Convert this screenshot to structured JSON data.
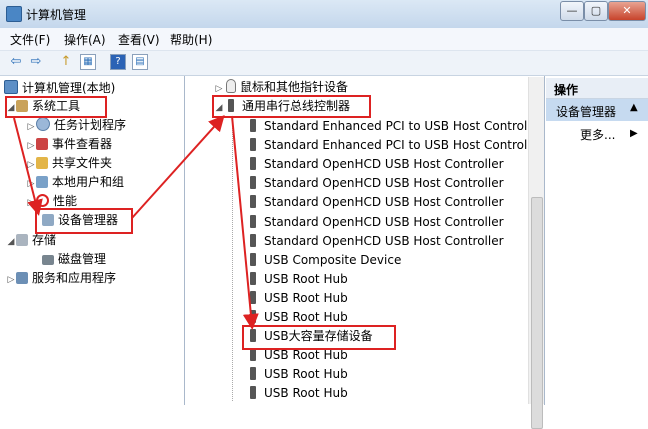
{
  "window": {
    "title": "计算机管理",
    "btn_min": "—",
    "btn_max": "▢",
    "btn_close": "✕"
  },
  "menu": {
    "file": "文件(F)",
    "action": "操作(A)",
    "view": "查看(V)",
    "help": "帮助(H)"
  },
  "toolbar": {
    "back": "⇦",
    "forward": "⇨",
    "up": "↑",
    "show": "▦",
    "help": "?",
    "pane": "▤"
  },
  "left_tree": {
    "root": "计算机管理(本地)",
    "system_tools": "系统工具",
    "task_scheduler": "任务计划程序",
    "event_viewer": "事件查看器",
    "shared_folders": "共享文件夹",
    "local_users": "本地用户和组",
    "performance": "性能",
    "device_manager": "设备管理器",
    "storage": "存储",
    "disk_management": "磁盘管理",
    "services_apps": "服务和应用程序"
  },
  "device_tree": {
    "mice": "鼠标和其他指针设备",
    "usb_controllers": "通用串行总线控制器",
    "items": [
      "Standard Enhanced PCI to USB Host Controller",
      "Standard Enhanced PCI to USB Host Controller",
      "Standard OpenHCD USB Host Controller",
      "Standard OpenHCD USB Host Controller",
      "Standard OpenHCD USB Host Controller",
      "Standard OpenHCD USB Host Controller",
      "Standard OpenHCD USB Host Controller",
      "USB Composite Device",
      "USB Root Hub",
      "USB Root Hub",
      "USB Root Hub",
      "USB大容量存储设备",
      "USB Root Hub",
      "USB Root Hub",
      "USB Root Hub"
    ]
  },
  "actions": {
    "header": "操作",
    "device_manager": "设备管理器",
    "more": "更多..."
  }
}
